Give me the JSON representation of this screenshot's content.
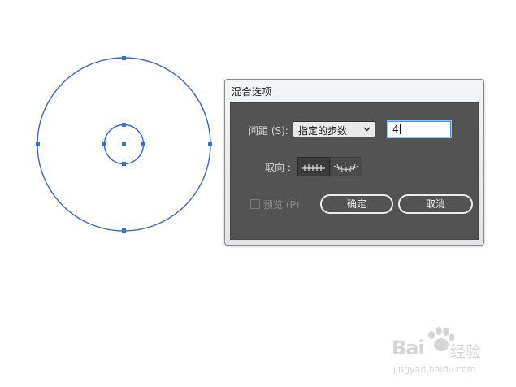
{
  "dialog": {
    "title": "混合选项",
    "spacing_label": "间距 (S):",
    "spacing_value": "指定的步数",
    "steps_value": "4",
    "orientation_label": "取向 :",
    "preview_label": "预览 (P)",
    "ok_label": "确定",
    "cancel_label": "取消"
  },
  "colors": {
    "shape_stroke": "#3a63c9",
    "anchor": "#2f6fe6",
    "dialog_body": "#535353"
  },
  "icons": {
    "dropdown": "chevron-down-icon",
    "align_page": "align-to-page-icon",
    "align_path": "align-to-path-icon",
    "cursor": "text-cursor-icon"
  },
  "watermark": {
    "main": "Bai",
    "cn": "经验",
    "url": "jingyan.baidu.com"
  }
}
